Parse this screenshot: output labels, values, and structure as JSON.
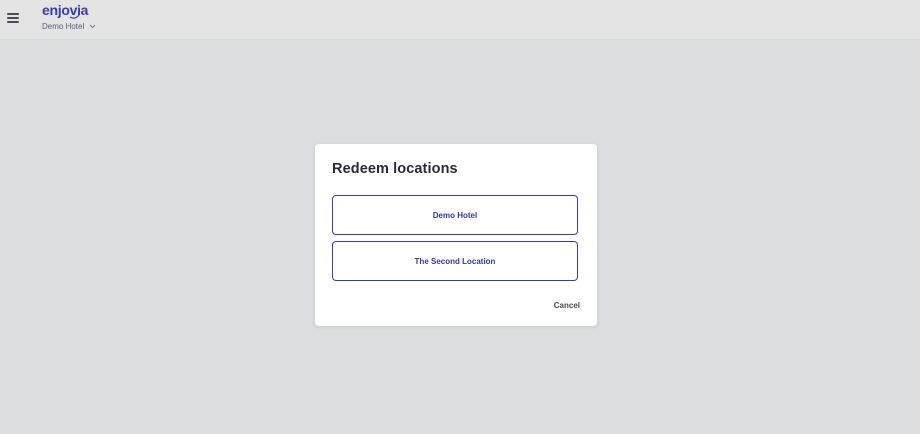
{
  "header": {
    "logo_text": "enjovia",
    "hotel_selector_label": "Demo Hotel",
    "icons": [
      "hamburger-menu-icon",
      "chevron-down-icon"
    ]
  },
  "modal": {
    "title": "Redeem locations",
    "locations": [
      {
        "label": "Demo Hotel"
      },
      {
        "label": "The Second Location"
      }
    ],
    "cancel_label": "Cancel"
  },
  "colors": {
    "accent": "#3535a8",
    "logo": "#3a3ab0",
    "overlay": "#dcdde0",
    "modal_bg": "#ffffff"
  }
}
